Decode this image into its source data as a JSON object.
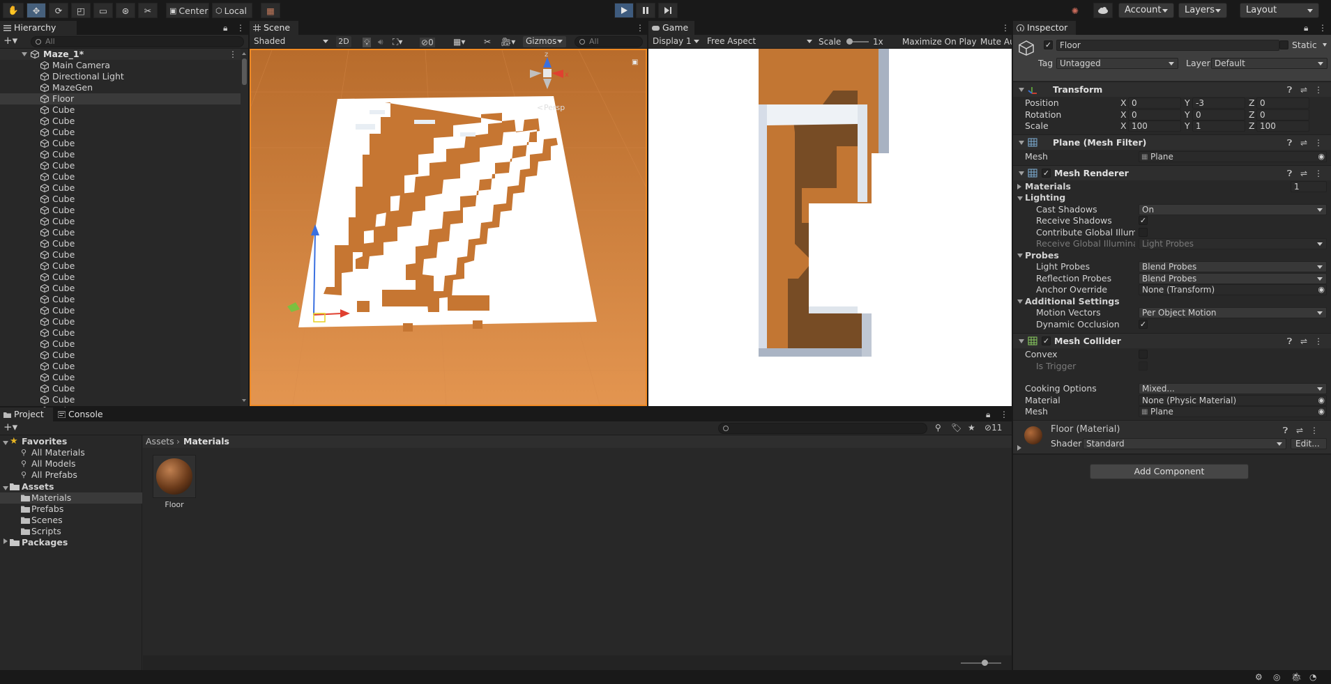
{
  "toolbar": {
    "pivot_label": "Center",
    "space_label": "Local",
    "account": "Account",
    "layers": "Layers",
    "layout": "Layout"
  },
  "hierarchy": {
    "tab": "Hierarchy",
    "search_placeholder": "All",
    "scene_name": "Maze_1*",
    "items": [
      "Main Camera",
      "Directional Light",
      "MazeGen",
      "Floor",
      "Cube",
      "Cube",
      "Cube",
      "Cube",
      "Cube",
      "Cube",
      "Cube",
      "Cube",
      "Cube",
      "Cube",
      "Cube",
      "Cube",
      "Cube",
      "Cube",
      "Cube",
      "Cube",
      "Cube",
      "Cube",
      "Cube",
      "Cube",
      "Cube",
      "Cube",
      "Cube",
      "Cube",
      "Cube",
      "Cube",
      "Cube",
      "Cube"
    ]
  },
  "scene": {
    "tab": "Scene",
    "shading": "Shaded",
    "mode_2d": "2D",
    "hidden_count": "0",
    "gizmos": "Gizmos",
    "search_placeholder": "All",
    "persp": "Persp",
    "axis_x": "x",
    "axis_z": "z"
  },
  "game": {
    "tab": "Game",
    "display": "Display 1",
    "aspect": "Free Aspect",
    "scale_label": "Scale",
    "scale_value": "1x",
    "maximize": "Maximize On Play",
    "mute": "Mute Au"
  },
  "inspector": {
    "tab": "Inspector",
    "object_name": "Floor",
    "static_label": "Static",
    "tag_label": "Tag",
    "tag_value": "Untagged",
    "layer_label": "Layer",
    "layer_value": "Default",
    "transform": {
      "title": "Transform",
      "position_label": "Position",
      "rotation_label": "Rotation",
      "scale_label": "Scale",
      "position": [
        "0",
        "-3",
        "0"
      ],
      "rotation": [
        "0",
        "0",
        "0"
      ],
      "scale": [
        "100",
        "1",
        "100"
      ],
      "x": "X",
      "y": "Y",
      "z": "Z"
    },
    "mesh_filter": {
      "title": "Plane (Mesh Filter)",
      "mesh_label": "Mesh",
      "mesh_value": "Plane"
    },
    "mesh_renderer": {
      "title": "Mesh Renderer",
      "materials_label": "Materials",
      "materials_count": "1",
      "lighting": "Lighting",
      "cast_shadows_label": "Cast Shadows",
      "cast_shadows_value": "On",
      "receive_shadows_label": "Receive Shadows",
      "contribute_gi_label": "Contribute Global Illuminat",
      "receive_gi_label": "Receive Global Illuminatio",
      "receive_gi_value": "Light Probes",
      "probes": "Probes",
      "light_probes_label": "Light Probes",
      "light_probes_value": "Blend Probes",
      "reflection_probes_label": "Reflection Probes",
      "reflection_probes_value": "Blend Probes",
      "anchor_override_label": "Anchor Override",
      "anchor_override_value": "None (Transform)",
      "additional": "Additional Settings",
      "motion_vectors_label": "Motion Vectors",
      "motion_vectors_value": "Per Object Motion",
      "dynamic_occlusion_label": "Dynamic Occlusion"
    },
    "mesh_collider": {
      "title": "Mesh Collider",
      "convex_label": "Convex",
      "is_trigger_label": "Is Trigger",
      "cooking_label": "Cooking Options",
      "cooking_value": "Mixed...",
      "material_label": "Material",
      "material_value": "None (Physic Material)",
      "mesh_label": "Mesh",
      "mesh_value": "Plane"
    },
    "material": {
      "title": "Floor (Material)",
      "shader_label": "Shader",
      "shader_value": "Standard",
      "edit": "Edit..."
    },
    "add_component": "Add Component"
  },
  "project": {
    "tab_project": "Project",
    "tab_console": "Console",
    "hidden_count": "11",
    "favorites": "Favorites",
    "fav_items": [
      "All Materials",
      "All Models",
      "All Prefabs"
    ],
    "assets": "Assets",
    "asset_folders": [
      "Materials",
      "Prefabs",
      "Scenes",
      "Scripts"
    ],
    "packages": "Packages",
    "breadcrumb_root": "Assets",
    "breadcrumb_current": "Materials",
    "asset_name": "Floor"
  },
  "colors": {
    "floor": "#ce7d3b",
    "selection": "#46607c",
    "accent_orange": "#f08a24",
    "background": "#282828"
  }
}
